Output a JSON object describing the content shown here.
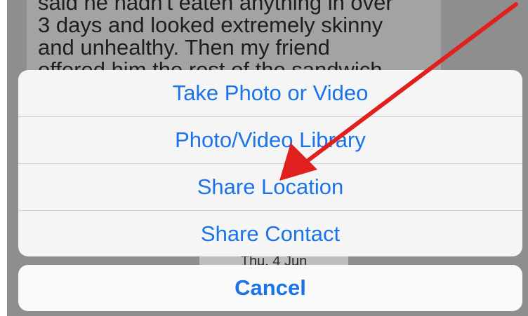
{
  "background_message": {
    "text": "said he hadn't eaten anything in over\n3 days and looked extremely skinny\nand unhealthy.  Then my friend\noffered him the rest of the sandwich"
  },
  "date_label": "Thu, 4 Jun",
  "action_sheet": {
    "items": [
      {
        "label": "Take Photo or Video"
      },
      {
        "label": "Photo/Video Library"
      },
      {
        "label": "Share Location"
      },
      {
        "label": "Share Contact"
      }
    ],
    "cancel_label": "Cancel"
  },
  "annotation": {
    "icon": "red-arrow-icon",
    "color": "#e0201c"
  },
  "colors": {
    "accent": "#1a73e8",
    "dim_background": "#8e8e8e",
    "sheet_background": "#f5f5f5"
  }
}
